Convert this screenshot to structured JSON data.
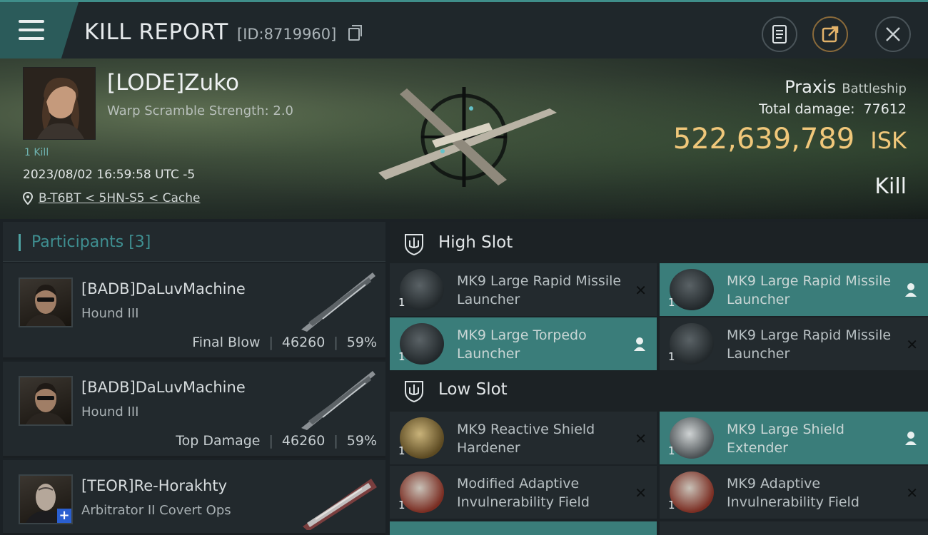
{
  "header": {
    "title": "KILL REPORT",
    "report_id": "[ID:8719960]"
  },
  "victim": {
    "name": "[LODE]Zuko",
    "subtitle": "Warp Scramble Strength: 2.0",
    "kill_tag": "1 Kill",
    "datetime": "2023/08/02 16:59:58 UTC -5",
    "location": "B-T6BT < 5HN-S5 < Cache",
    "ship": "Praxis",
    "ship_class": "Battleship",
    "total_damage_label": "Total damage:",
    "total_damage": "77612",
    "isk_value": "522,639,789",
    "isk_unit": "ISK",
    "result": "Kill"
  },
  "participants": {
    "header": "Participants [3]",
    "items": [
      {
        "name": "[BADB]DaLuvMachine",
        "ship": "Hound III",
        "role": "Final Blow",
        "damage": "46260",
        "pct": "59%"
      },
      {
        "name": "[BADB]DaLuvMachine",
        "ship": "Hound III",
        "role": "Top Damage",
        "damage": "46260",
        "pct": "59%"
      },
      {
        "name": "[TEOR]Re-Horakhty",
        "ship": "Arbitrator II Covert Ops",
        "role": "",
        "damage": "",
        "pct": ""
      }
    ]
  },
  "high_slot": {
    "label": "High Slot",
    "modules": [
      {
        "name": "MK9 Large Rapid Missile Launcher",
        "qty": "1",
        "state": "destroyed"
      },
      {
        "name": "MK9 Large Rapid Missile Launcher",
        "qty": "1",
        "state": "dropped"
      },
      {
        "name": "MK9 Large Torpedo Launcher",
        "qty": "1",
        "state": "dropped"
      },
      {
        "name": "MK9 Large Rapid Missile Launcher",
        "qty": "1",
        "state": "destroyed"
      }
    ]
  },
  "low_slot": {
    "label": "Low Slot",
    "modules": [
      {
        "name": "MK9 Reactive Shield Hardener",
        "qty": "1",
        "state": "destroyed"
      },
      {
        "name": "MK9 Large Shield Extender",
        "qty": "1",
        "state": "dropped"
      },
      {
        "name": "Modified Adaptive Invulnerability Field",
        "qty": "1",
        "state": "destroyed"
      },
      {
        "name": "MK9 Adaptive Invulnerability Field",
        "qty": "1",
        "state": "destroyed"
      }
    ]
  },
  "icons": {
    "menu": "hamburger-icon",
    "copy": "copy-icon",
    "doc": "document-icon",
    "share": "share-icon",
    "close": "close-icon",
    "location": "map-pin-icon",
    "destroyed": "x-icon",
    "dropped": "person-icon"
  },
  "colors": {
    "accent": "#3a7d7a",
    "isk": "#f0c77a",
    "participants": "#3f8f91"
  }
}
